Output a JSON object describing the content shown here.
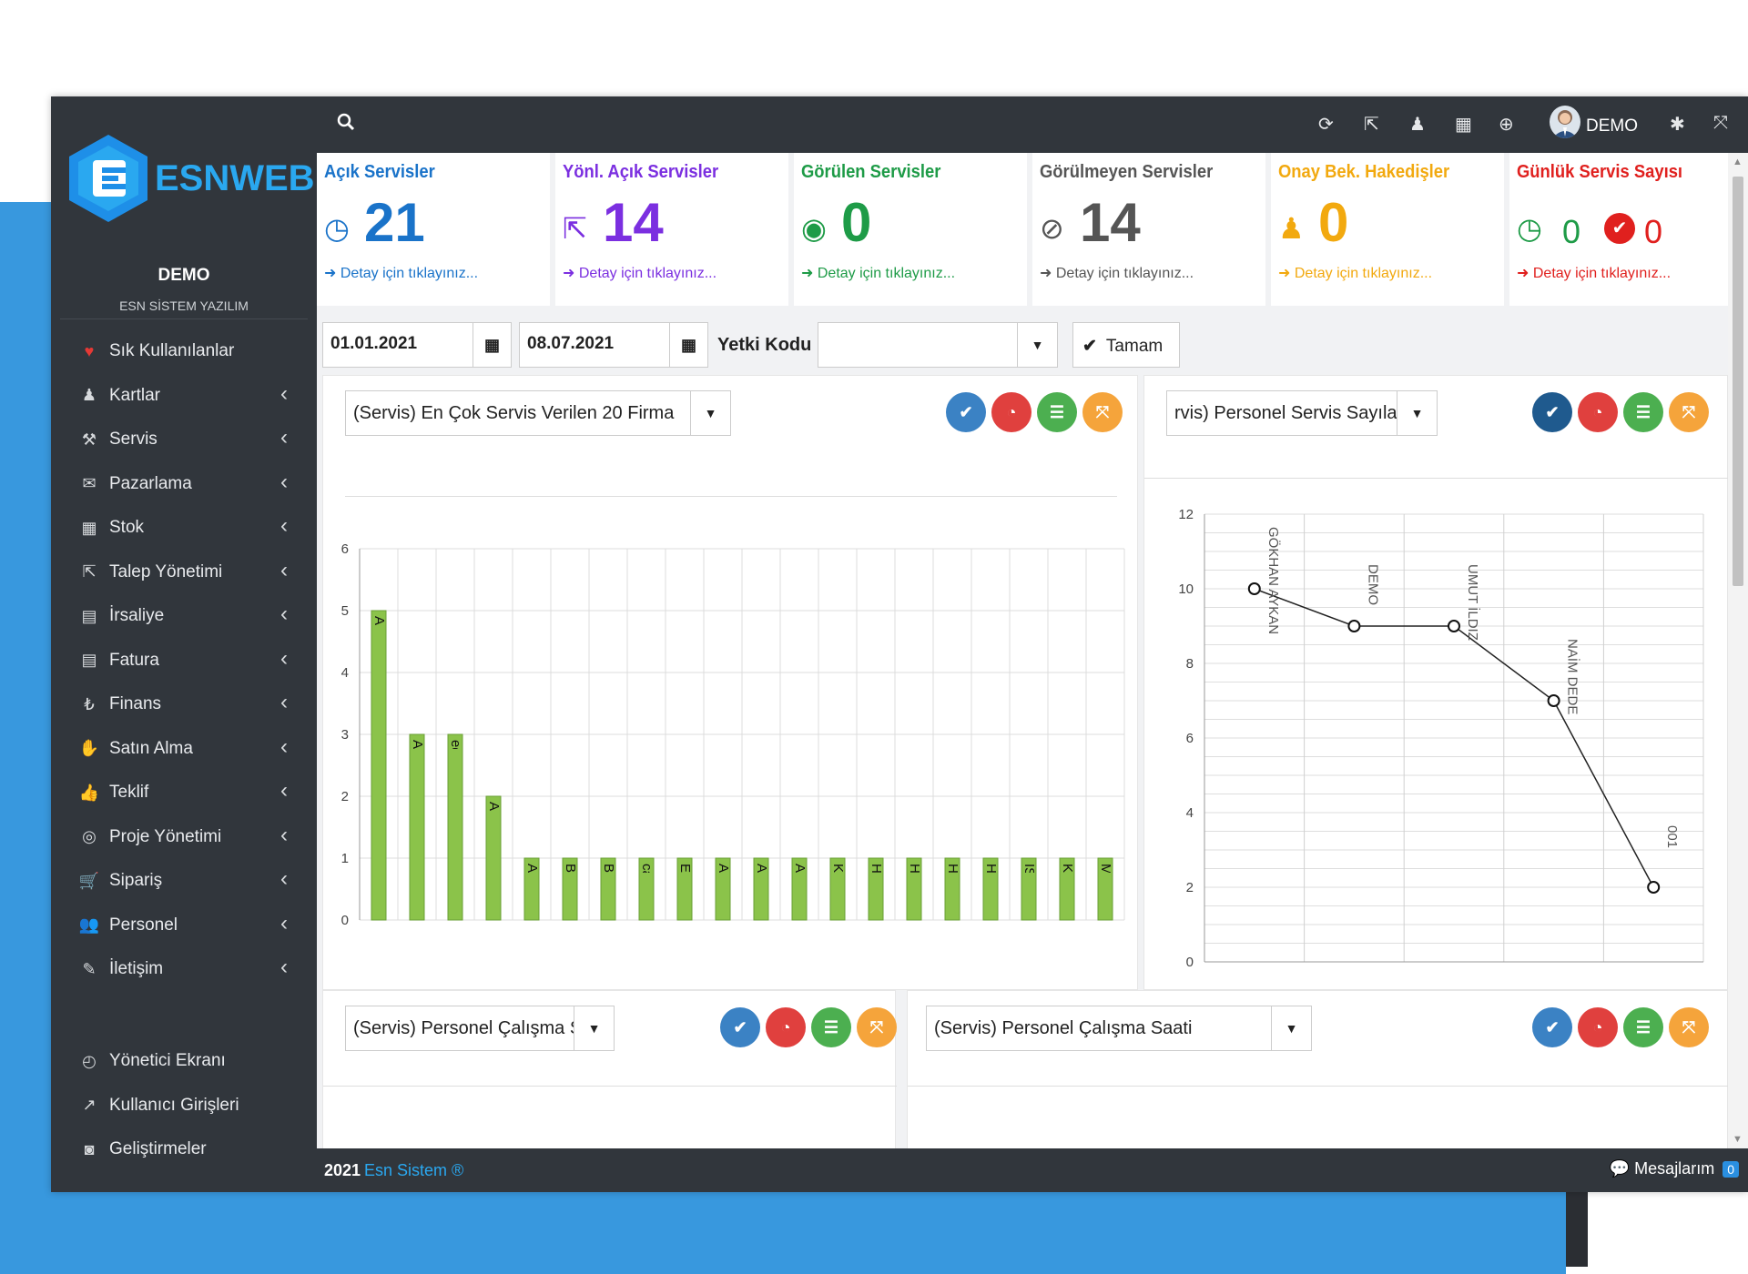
{
  "app": {
    "logo_text": "ESNWEB",
    "user": "DEMO",
    "company": "ESN SİSTEM YAZILIM"
  },
  "sidebar": {
    "items": [
      {
        "label": "Sık Kullanılanlar",
        "icon": "heart-icon"
      },
      {
        "label": "Kartlar",
        "icon": "user-icon"
      },
      {
        "label": "Servis",
        "icon": "wrench-icon"
      },
      {
        "label": "Pazarlama",
        "icon": "comments-icon"
      },
      {
        "label": "Stok",
        "icon": "grid-icon"
      },
      {
        "label": "Talep Yönetimi",
        "icon": "share-square-icon"
      },
      {
        "label": "İrsaliye",
        "icon": "file-icon"
      },
      {
        "label": "Fatura",
        "icon": "file-text-icon"
      },
      {
        "label": "Finans",
        "icon": "lira-icon"
      },
      {
        "label": "Satın Alma",
        "icon": "hand-holding-icon"
      },
      {
        "label": "Teklif",
        "icon": "thumbs-up-icon"
      },
      {
        "label": "Proje Yönetimi",
        "icon": "life-ring-icon"
      },
      {
        "label": "Sipariş",
        "icon": "cart-icon"
      },
      {
        "label": "Personel",
        "icon": "users-icon"
      },
      {
        "label": "İletişim",
        "icon": "edit-icon"
      }
    ],
    "bottom_items": [
      {
        "label": "Yönetici Ekranı",
        "icon": "dashboard-icon"
      },
      {
        "label": "Kullanıcı Girişleri",
        "icon": "line-chart-icon"
      },
      {
        "label": "Geliştirmeler",
        "icon": "rss-icon"
      }
    ]
  },
  "topbar": {
    "user_label": "DEMO"
  },
  "stats": [
    {
      "title": "Açık Servisler",
      "value": "21",
      "detail": "Detay için tıklayınız...",
      "color": "#1a73c9"
    },
    {
      "title": "Yönl. Açık Servisler",
      "value": "14",
      "detail": "Detay için tıklayınız...",
      "color": "#7b2fe0"
    },
    {
      "title": "Görülen Servisler",
      "value": "0",
      "detail": "Detay için tıklayınız...",
      "color": "#1e9b47"
    },
    {
      "title": "Görülmeyen Servisler",
      "value": "14",
      "detail": "Detay için tıklayınız...",
      "color": "#555555"
    },
    {
      "title": "Onay Bek. Hakedişler",
      "value": "0",
      "detail": "Detay için tıklayınız...",
      "color": "#f2a90f"
    },
    {
      "title": "Günlük Servis Sayısı",
      "value_green": "0",
      "value_red": "0",
      "detail": "Detay için tıklayınız...",
      "color": "#e0201e"
    }
  ],
  "filters": {
    "date_start": "01.01.2021",
    "date_end": "08.07.2021",
    "yetki_label": "Yetki Kodu",
    "yetki_value": "",
    "ok_label": "Tamam"
  },
  "panels": {
    "p1_select": "(Servis) En Çok Servis Verilen 20 Firma",
    "p2_select": "rvis) Personel Servis Sayıları",
    "p3_select": "(Servis) Personel Çalışma Sa",
    "p4_select": "(Servis) Personel Çalışma Saati"
  },
  "chart_data": [
    {
      "type": "bar",
      "categories": [
        "ABDULLAH YILMAZ",
        "ACIBADEM ÜNİVERSİTE",
        "edirne adliyesi",
        "ALAADDİN KIZIL",
        "ALİ BASKIN",
        "BİLGE ÇA",
        "BİRSEL Ö",
        "cavit elibol",
        "ENES ARC",
        "ARÇELİK A",
        "ADEM TEK",
        "AKSA JEN",
        "Kılıç Hold",
        "HALİL KES",
        "HASAN AB",
        "HÜSEYİN E",
        "HÜSEYİN Ç",
        "İSMAİL ALT",
        "KARTAL D",
        "MARANG"
      ],
      "values": [
        5,
        3,
        3,
        2,
        1,
        1,
        1,
        1,
        1,
        1,
        1,
        1,
        1,
        1,
        1,
        1,
        1,
        1,
        1,
        1
      ],
      "ylim": [
        0,
        6
      ],
      "yticks": [
        0,
        1,
        2,
        3,
        4,
        5,
        6
      ],
      "bar_color": "#8bc34a",
      "grid": true
    },
    {
      "type": "line",
      "categories": [
        "GÖKHAN AYKAN",
        "DEMO",
        "UMUT İLDIZ",
        "NAİM DEDE",
        "001"
      ],
      "values": [
        10,
        9,
        9,
        7,
        2
      ],
      "ylim": [
        0,
        12
      ],
      "yticks": [
        0,
        2,
        4,
        6,
        8,
        10,
        12
      ],
      "grid": true
    }
  ],
  "footer": {
    "year": "2021",
    "brand": "Esn Sistem ®",
    "messages_label": "Mesajlarım",
    "messages_count": "0"
  }
}
